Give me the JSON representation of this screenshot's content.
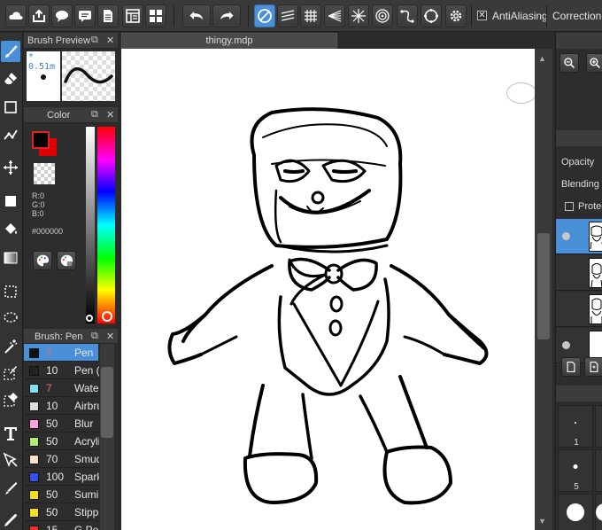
{
  "toolbar": {
    "antialiasing_label": "AntiAliasing",
    "antialiasing_checked": "✕",
    "correction_label": "Correction"
  },
  "document": {
    "tab_title": "thingy.mdp"
  },
  "brush_preview_panel": {
    "title": "Brush Preview",
    "size_label": "* 0.51m"
  },
  "color_panel": {
    "title": "Color",
    "r_label": "R:0",
    "g_label": "G:0",
    "b_label": "B:0",
    "hex_label": "#000000",
    "foreground_color": "#000000",
    "background_color": "#e00000"
  },
  "brush_panel": {
    "title": "Brush: Pen",
    "brushes": [
      {
        "size": "7",
        "name": "Pen",
        "color": "#111111",
        "size_red": true,
        "selected": true
      },
      {
        "size": "10",
        "name": "Pen (",
        "color": "#222222",
        "size_red": false,
        "selected": false
      },
      {
        "size": "7",
        "name": "Watercolor",
        "color": "#7fe0f0",
        "size_red": true,
        "selected": false
      },
      {
        "size": "10",
        "name": "Airbrush",
        "color": "#dddddd",
        "size_red": false,
        "selected": false
      },
      {
        "size": "50",
        "name": "Blur",
        "color": "#ffa0e0",
        "size_red": false,
        "selected": false
      },
      {
        "size": "50",
        "name": "Acrylic",
        "color": "#b0ee70",
        "size_red": false,
        "selected": false
      },
      {
        "size": "70",
        "name": "Smudge",
        "color": "#ffe0c8",
        "size_red": false,
        "selected": false
      },
      {
        "size": "100",
        "name": "Sparkle",
        "color": "#3050f0",
        "size_red": false,
        "selected": false
      },
      {
        "size": "50",
        "name": "Sumi",
        "color": "#f0e020",
        "size_red": false,
        "selected": false
      },
      {
        "size": "50",
        "name": "Stipple",
        "color": "#f0e020",
        "size_red": false,
        "selected": false
      },
      {
        "size": "15",
        "name": "G Pen",
        "color": "#ee3030",
        "size_red": false,
        "selected": false
      }
    ]
  },
  "layers_panel": {
    "opacity_label": "Opacity",
    "blending_label": "Blending",
    "protect_label": "Protect Alpha"
  },
  "brush_size_panel": {
    "sizes": [
      "1",
      "5",
      ""
    ]
  },
  "colors": {
    "accent": "#4a90d9"
  }
}
